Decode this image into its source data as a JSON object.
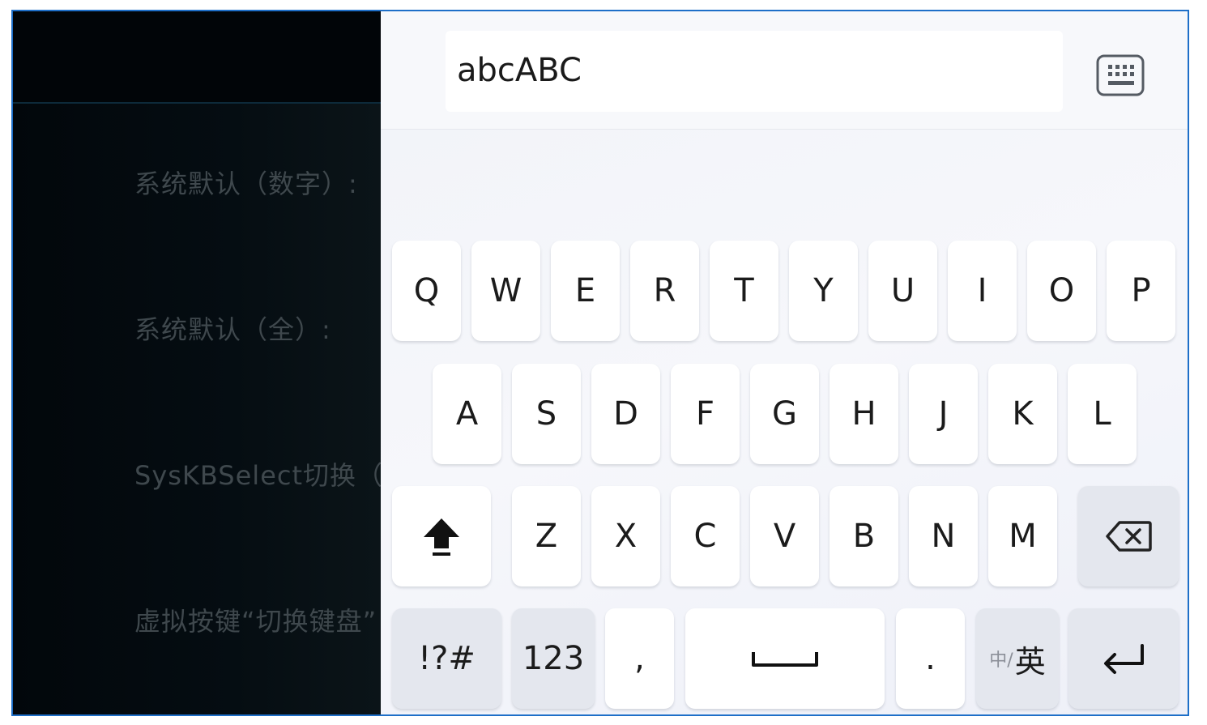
{
  "left_panel": {
    "labels": [
      "系统默认（数字）:",
      "系统默认（全）:",
      "SysKBSelect切换（全",
      "虚拟按键“切换键盘”"
    ]
  },
  "input": {
    "value": "abcABC"
  },
  "keyboard": {
    "row1": [
      "Q",
      "W",
      "E",
      "R",
      "T",
      "Y",
      "U",
      "I",
      "O",
      "P"
    ],
    "row2": [
      "A",
      "S",
      "D",
      "F",
      "G",
      "H",
      "J",
      "K",
      "L"
    ],
    "row3": [
      "Z",
      "X",
      "C",
      "V",
      "B",
      "N",
      "M"
    ],
    "symbols_label": "!?#",
    "numbers_label": "123",
    "comma_label": ",",
    "period_label": ".",
    "lang_small": "中/",
    "lang_big": "英"
  },
  "icons": {
    "keyboard_toggle": "keyboard-icon",
    "shift": "shift-arrow-icon",
    "backspace": "backspace-icon",
    "space": "space-bar-icon",
    "enter": "enter-return-icon"
  },
  "colors": {
    "frame_border": "#1e6fc8",
    "left_background": "#02080c",
    "keyboard_background": "#f1f3f8",
    "key_background": "#ffffff",
    "function_key_background": "#e4e7ee"
  }
}
